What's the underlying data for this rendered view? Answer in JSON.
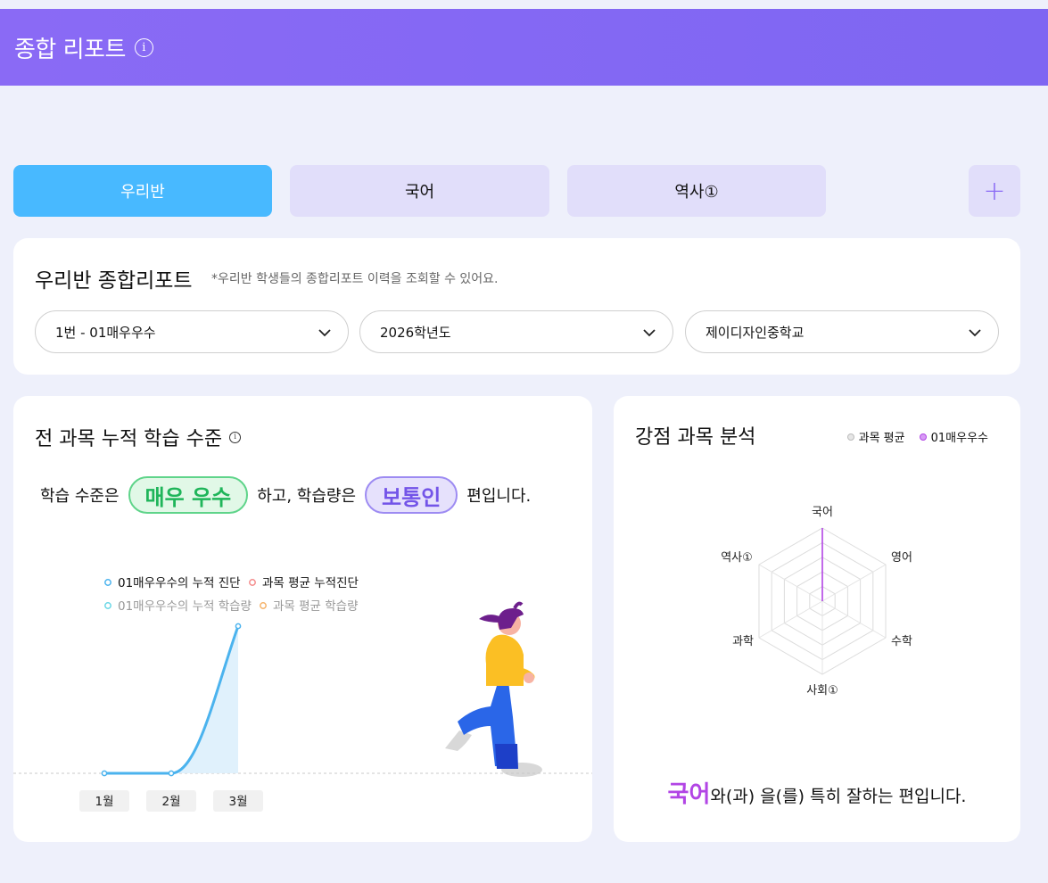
{
  "header": {
    "title": "종합 리포트",
    "info_glyph": "i"
  },
  "tabs": [
    {
      "label": "우리반",
      "active": true
    },
    {
      "label": "국어",
      "active": false
    },
    {
      "label": "역사①",
      "active": false
    }
  ],
  "add_tab_glyph": "+",
  "report": {
    "title": "우리반 종합리포트",
    "subtitle": "*우리반 학생들의 종합리포트 이력을 조회할 수 있어요.",
    "selects": [
      {
        "value": "1번 - 01매우우수"
      },
      {
        "value": "2026학년도"
      },
      {
        "value": "제이디자인중학교"
      }
    ]
  },
  "level": {
    "title": "전 과목 누적 학습 수준",
    "sentence_prefix": "학습 수준은",
    "level_badge": "매우 우수",
    "sentence_middle": "하고, 학습량은",
    "amount_badge": "보통인",
    "sentence_suffix": "편입니다."
  },
  "colors": {
    "accent": "#8a6af5",
    "active_tab": "#48b9ff",
    "tab_bg": "#e1defa",
    "good": "#1fb55a",
    "purple": "#7354e8",
    "highlight": "#b245e5"
  },
  "chart_data": [
    {
      "type": "line",
      "categories": [
        "1월",
        "2월",
        "3월"
      ],
      "series": [
        {
          "name": "01매우우수의 누적 진단",
          "values": [
            0,
            0,
            100
          ],
          "color": "#4bb3ee"
        },
        {
          "name": "과목 평균 누적진단",
          "values": [],
          "color": "#f48c8c"
        },
        {
          "name": "01매우우수의 누적 학습량",
          "values": [
            0,
            0,
            100
          ],
          "color": "#6ad7e6"
        },
        {
          "name": "과목 평균 학습량",
          "values": [],
          "color": "#f5b36a"
        }
      ],
      "ylim": [
        0,
        100
      ],
      "grid": false,
      "legend": "top"
    },
    {
      "type": "radar",
      "axes": [
        "국어",
        "영어",
        "수학",
        "사회①",
        "과학",
        "역사①"
      ],
      "series": [
        {
          "name": "과목 평균",
          "values": [
            0,
            0,
            0,
            0,
            0,
            0
          ],
          "color": "#cccccc"
        },
        {
          "name": "01매우우수",
          "values": [
            100,
            0,
            0,
            0,
            0,
            0
          ],
          "color": "#b245e5"
        }
      ],
      "range": [
        0,
        100
      ],
      "legend": "top-right"
    }
  ],
  "strength": {
    "title": "강점 과목 분석",
    "highlight_subject": "국어",
    "sentence": "와(과) 을(를) 특히 잘하는 편입니다."
  }
}
